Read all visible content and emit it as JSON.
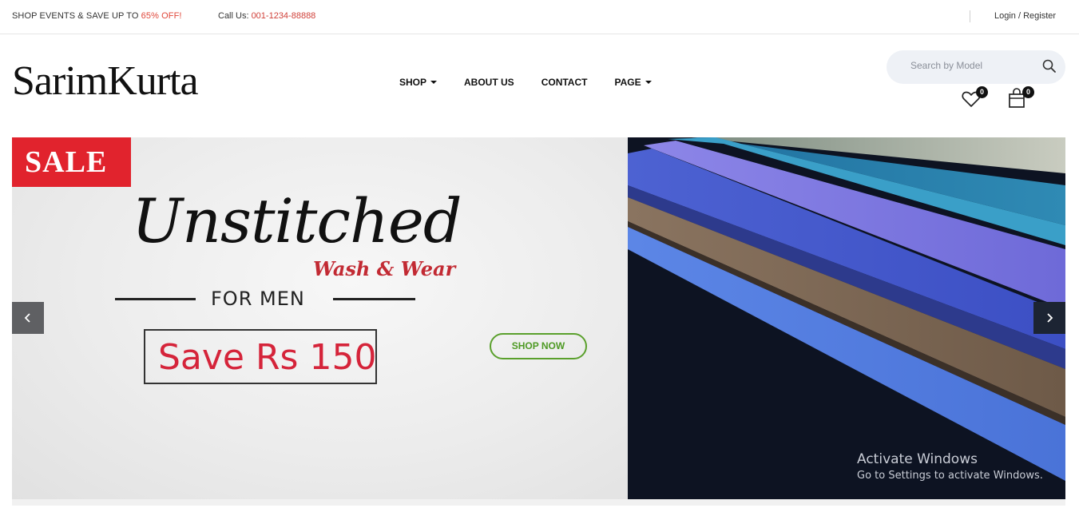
{
  "topbar": {
    "promo_prefix": "SHOP EVENTS & SAVE UP TO ",
    "promo_highlight": "65% OFF!",
    "call_label": "Call Us: ",
    "call_number": "001-1234-88888",
    "login_register": "Login / Register"
  },
  "header": {
    "logo": "SarimKurta",
    "nav": [
      {
        "label": "SHOP",
        "dropdown": true
      },
      {
        "label": "ABOUT US",
        "dropdown": false
      },
      {
        "label": "CONTACT",
        "dropdown": false
      },
      {
        "label": "PAGE",
        "dropdown": true
      }
    ],
    "search_placeholder": "Search by Model",
    "wishlist_count": "0",
    "cart_count": "0"
  },
  "banner": {
    "sale": "SALE",
    "headline": "Unstitched",
    "subheadline": "Wash & Wear",
    "audience": "FOR MEN",
    "offer_prefix": "Save Rs ",
    "offer_amount": "150",
    "cta": "SHOP NOW"
  },
  "watermark": {
    "title": "Activate Windows",
    "subtitle": "Go to Settings to activate Windows."
  },
  "colors": {
    "accent_red": "#e0473a",
    "sale_red": "#e1232d",
    "cta_green": "#5aa02c"
  },
  "icons": [
    "search-icon",
    "heart-icon",
    "shopping-bag-icon",
    "chevron-left-icon",
    "chevron-right-icon",
    "caret-down-icon"
  ]
}
